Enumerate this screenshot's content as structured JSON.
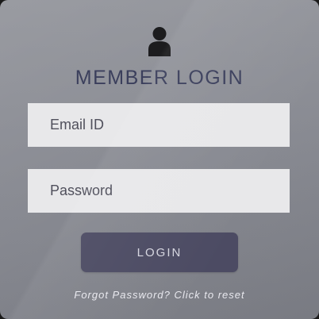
{
  "login_form": {
    "title": "MEMBER LOGIN",
    "icon": "user-icon",
    "email": {
      "placeholder": "Email ID",
      "value": ""
    },
    "password": {
      "placeholder": "Password",
      "value": ""
    },
    "login_button_label": "LOGIN",
    "forgot_link_text": "Forgot Password? Click to reset"
  },
  "colors": {
    "title": "#3b3f5c",
    "button": "#4c4b63",
    "input_background": "#e8e8ea",
    "icon": "#1c1c1e"
  }
}
